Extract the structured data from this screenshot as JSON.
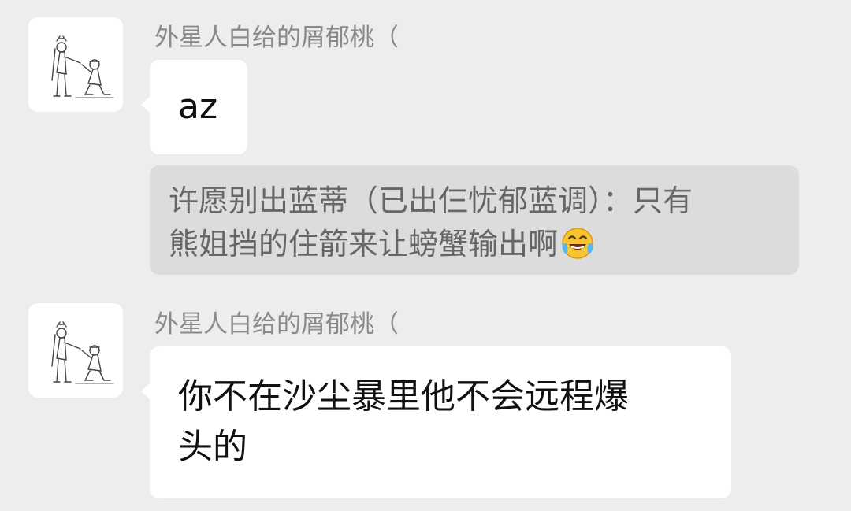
{
  "messages": [
    {
      "sender": "外星人白给的屑郁桃（",
      "text": "az"
    },
    {
      "sender": "外星人白给的屑郁桃（",
      "text_line1": "你不在沙尘暴里他不会远程爆",
      "text_line2": "头的"
    }
  ],
  "quote": {
    "line1": "许愿别出蓝蒂（已出仨忧郁蓝调）：只有",
    "line2": "熊姐挡的住箭来让螃蟹输出啊",
    "emoji": "face-with-tears-of-joy"
  },
  "colors": {
    "background": "#ededed",
    "bubble": "#ffffff",
    "quote_background": "#dcdcdc",
    "sender_name": "#8a8a8a",
    "quote_text": "#666666"
  }
}
